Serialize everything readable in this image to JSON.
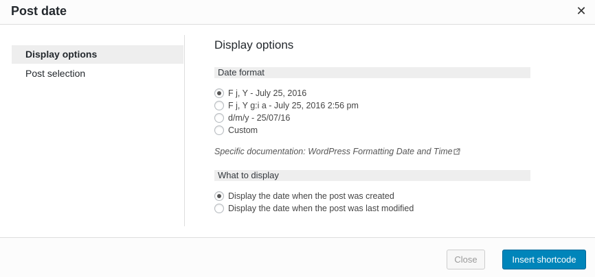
{
  "dialog": {
    "title": "Post date"
  },
  "sidebar": {
    "items": [
      {
        "label": "Display options",
        "active": true
      },
      {
        "label": "Post selection",
        "active": false
      }
    ]
  },
  "main": {
    "heading": "Display options",
    "date_format": {
      "label": "Date format",
      "options": [
        {
          "label": "F j, Y - July 25, 2016",
          "checked": true
        },
        {
          "label": "F j, Y g:i a - July 25, 2016 2:56 pm",
          "checked": false
        },
        {
          "label": "d/m/y - 25/07/16",
          "checked": false
        },
        {
          "label": "Custom",
          "checked": false
        }
      ],
      "doc_prefix": "Specific documentation:",
      "doc_link": "WordPress Formatting Date and Time"
    },
    "what_to_display": {
      "label": "What to display",
      "options": [
        {
          "label": "Display the date when the post was created",
          "checked": true
        },
        {
          "label": "Display the date when the post was last modified",
          "checked": false
        }
      ]
    }
  },
  "footer": {
    "close_label": "Close",
    "insert_label": "Insert shortcode"
  },
  "colors": {
    "primary_button": "#0085ba",
    "active_tab_bg": "#eeeeee",
    "section_head_bg": "#eeeeee"
  }
}
